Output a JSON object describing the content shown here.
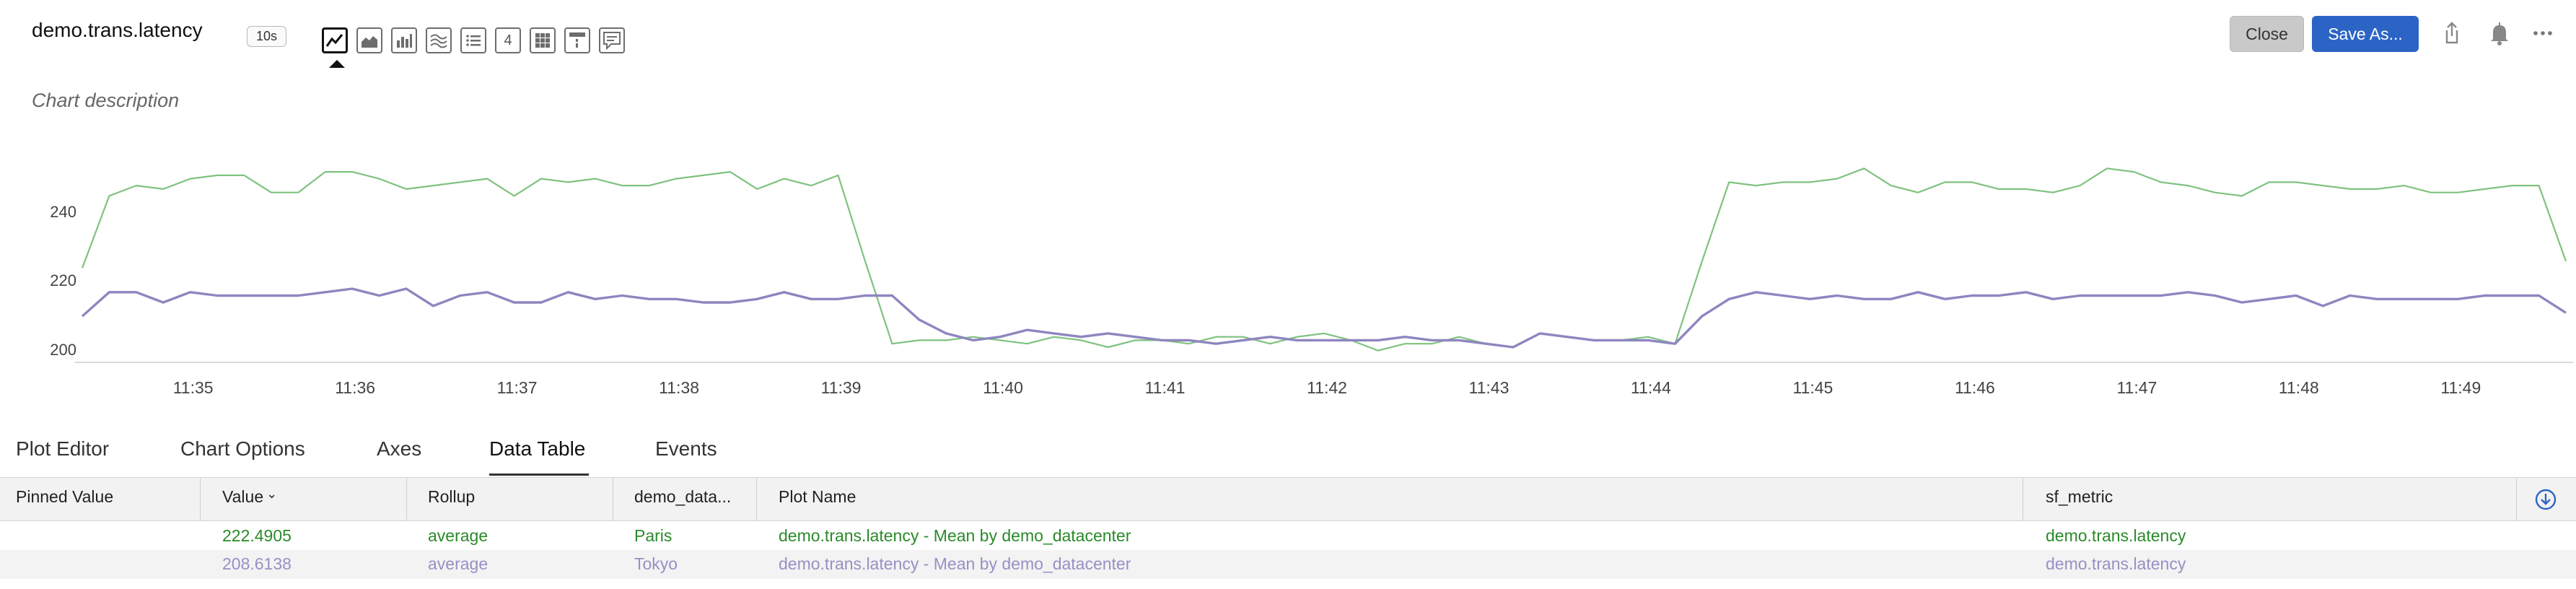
{
  "header": {
    "title": "demo.trans.latency",
    "resolution": "10s",
    "description_placeholder": "Chart description",
    "close_label": "Close",
    "save_as_label": "Save As..."
  },
  "toolbar_icons": [
    "line-chart-icon",
    "area-chart-icon",
    "column-chart-icon",
    "histogram-icon",
    "list-chart-icon",
    "single-value-icon",
    "heatmap-icon",
    "event-feed-icon",
    "text-note-icon"
  ],
  "toolbar_single_value_glyph": "4",
  "header_icons": [
    "share-icon",
    "bell-icon",
    "more-icon"
  ],
  "colors": {
    "series_paris": "#7fc27f",
    "series_tokyo": "#8e86bf",
    "accent": "#2b64c5",
    "row_paris_text": "#2a8a2a",
    "row_tokyo_text": "#9a8fc4"
  },
  "chart_data": {
    "type": "line",
    "x": [
      "11:34:20",
      "11:34:30",
      "11:34:40",
      "11:34:50",
      "11:35:00",
      "11:35:10",
      "11:35:20",
      "11:35:30",
      "11:35:40",
      "11:35:50",
      "11:36:00",
      "11:36:10",
      "11:36:20",
      "11:36:30",
      "11:36:40",
      "11:36:50",
      "11:37:00",
      "11:37:10",
      "11:37:20",
      "11:37:30",
      "11:37:40",
      "11:37:50",
      "11:38:00",
      "11:38:10",
      "11:38:20",
      "11:38:30",
      "11:38:40",
      "11:38:50",
      "11:39:00",
      "11:39:10",
      "11:39:20",
      "11:39:30",
      "11:39:40",
      "11:39:50",
      "11:40:00",
      "11:40:10",
      "11:40:20",
      "11:40:30",
      "11:40:40",
      "11:40:50",
      "11:41:00",
      "11:41:10",
      "11:41:20",
      "11:41:30",
      "11:41:40",
      "11:41:50",
      "11:42:00",
      "11:42:10",
      "11:42:20",
      "11:42:30",
      "11:42:40",
      "11:42:50",
      "11:43:00",
      "11:43:10",
      "11:43:20",
      "11:43:30",
      "11:43:40",
      "11:43:50",
      "11:44:00",
      "11:44:10",
      "11:44:20",
      "11:44:30",
      "11:44:40",
      "11:44:50",
      "11:45:00",
      "11:45:10",
      "11:45:20",
      "11:45:30",
      "11:45:40",
      "11:45:50",
      "11:46:00",
      "11:46:10",
      "11:46:20",
      "11:46:30",
      "11:46:40",
      "11:46:50",
      "11:47:00",
      "11:47:10",
      "11:47:20",
      "11:47:30",
      "11:47:40",
      "11:47:50",
      "11:48:00",
      "11:48:10",
      "11:48:20",
      "11:48:30",
      "11:48:40",
      "11:48:50",
      "11:49:00",
      "11:49:10",
      "11:49:20",
      "11:49:30",
      "11:49:40"
    ],
    "series": [
      {
        "values": [
          224,
          245,
          248,
          247,
          250,
          251,
          251,
          246,
          246,
          252,
          252,
          250,
          247,
          248,
          249,
          250,
          245,
          250,
          249,
          250,
          248,
          248,
          250,
          251,
          252,
          247,
          250,
          248,
          251,
          226,
          202,
          203,
          203,
          204,
          203,
          202,
          204,
          203,
          201,
          203,
          203,
          202,
          204,
          204,
          202,
          204,
          205,
          203,
          200,
          202,
          202,
          204,
          202,
          201,
          205,
          204,
          203,
          203,
          204,
          202,
          226,
          249,
          248,
          249,
          249,
          250,
          253,
          248,
          246,
          249,
          249,
          247,
          247,
          246,
          248,
          253,
          252,
          249,
          248,
          246,
          245,
          249,
          249,
          248,
          247,
          247,
          248,
          246,
          246,
          247,
          248,
          248,
          226
        ]
      },
      {
        "values": [
          210,
          217,
          217,
          214,
          217,
          216,
          216,
          216,
          216,
          217,
          218,
          216,
          218,
          213,
          216,
          217,
          214,
          214,
          217,
          215,
          216,
          215,
          215,
          214,
          214,
          215,
          217,
          215,
          215,
          216,
          216,
          209,
          205,
          203,
          204,
          206,
          205,
          204,
          205,
          204,
          203,
          203,
          202,
          203,
          204,
          203,
          203,
          203,
          203,
          204,
          203,
          203,
          202,
          201,
          205,
          204,
          203,
          203,
          203,
          202,
          210,
          215,
          217,
          216,
          215,
          216,
          215,
          215,
          217,
          215,
          216,
          216,
          217,
          215,
          216,
          216,
          216,
          216,
          217,
          216,
          214,
          215,
          216,
          213,
          216,
          215,
          215,
          215,
          215,
          216,
          216,
          216,
          211
        ]
      }
    ],
    "ylim": [
      197,
      260
    ],
    "yticks": [
      200,
      220,
      240
    ],
    "xtick_labels": [
      "11:35",
      "11:36",
      "11:37",
      "11:38",
      "11:39",
      "11:40",
      "11:41",
      "11:42",
      "11:43",
      "11:44",
      "11:45",
      "11:46",
      "11:47",
      "11:48",
      "11:49"
    ]
  },
  "tabs": [
    {
      "label": "Plot Editor",
      "active": false
    },
    {
      "label": "Chart Options",
      "active": false
    },
    {
      "label": "Axes",
      "active": false
    },
    {
      "label": "Data Table",
      "active": true
    },
    {
      "label": "Events",
      "active": false
    }
  ],
  "data_table": {
    "columns": [
      "Pinned Value",
      "Value",
      "Rollup",
      "demo_data...",
      "Plot Name",
      "sf_metric"
    ],
    "sort_indicator": "⌄",
    "rows": [
      {
        "pinned": "",
        "value": "222.4905",
        "rollup": "average",
        "datacenter": "Paris",
        "plot_name": "demo.trans.latency - Mean by demo_datacenter",
        "metric": "demo.trans.latency"
      },
      {
        "pinned": "",
        "value": "208.6138",
        "rollup": "average",
        "datacenter": "Tokyo",
        "plot_name": "demo.trans.latency - Mean by demo_datacenter",
        "metric": "demo.trans.latency"
      }
    ]
  }
}
